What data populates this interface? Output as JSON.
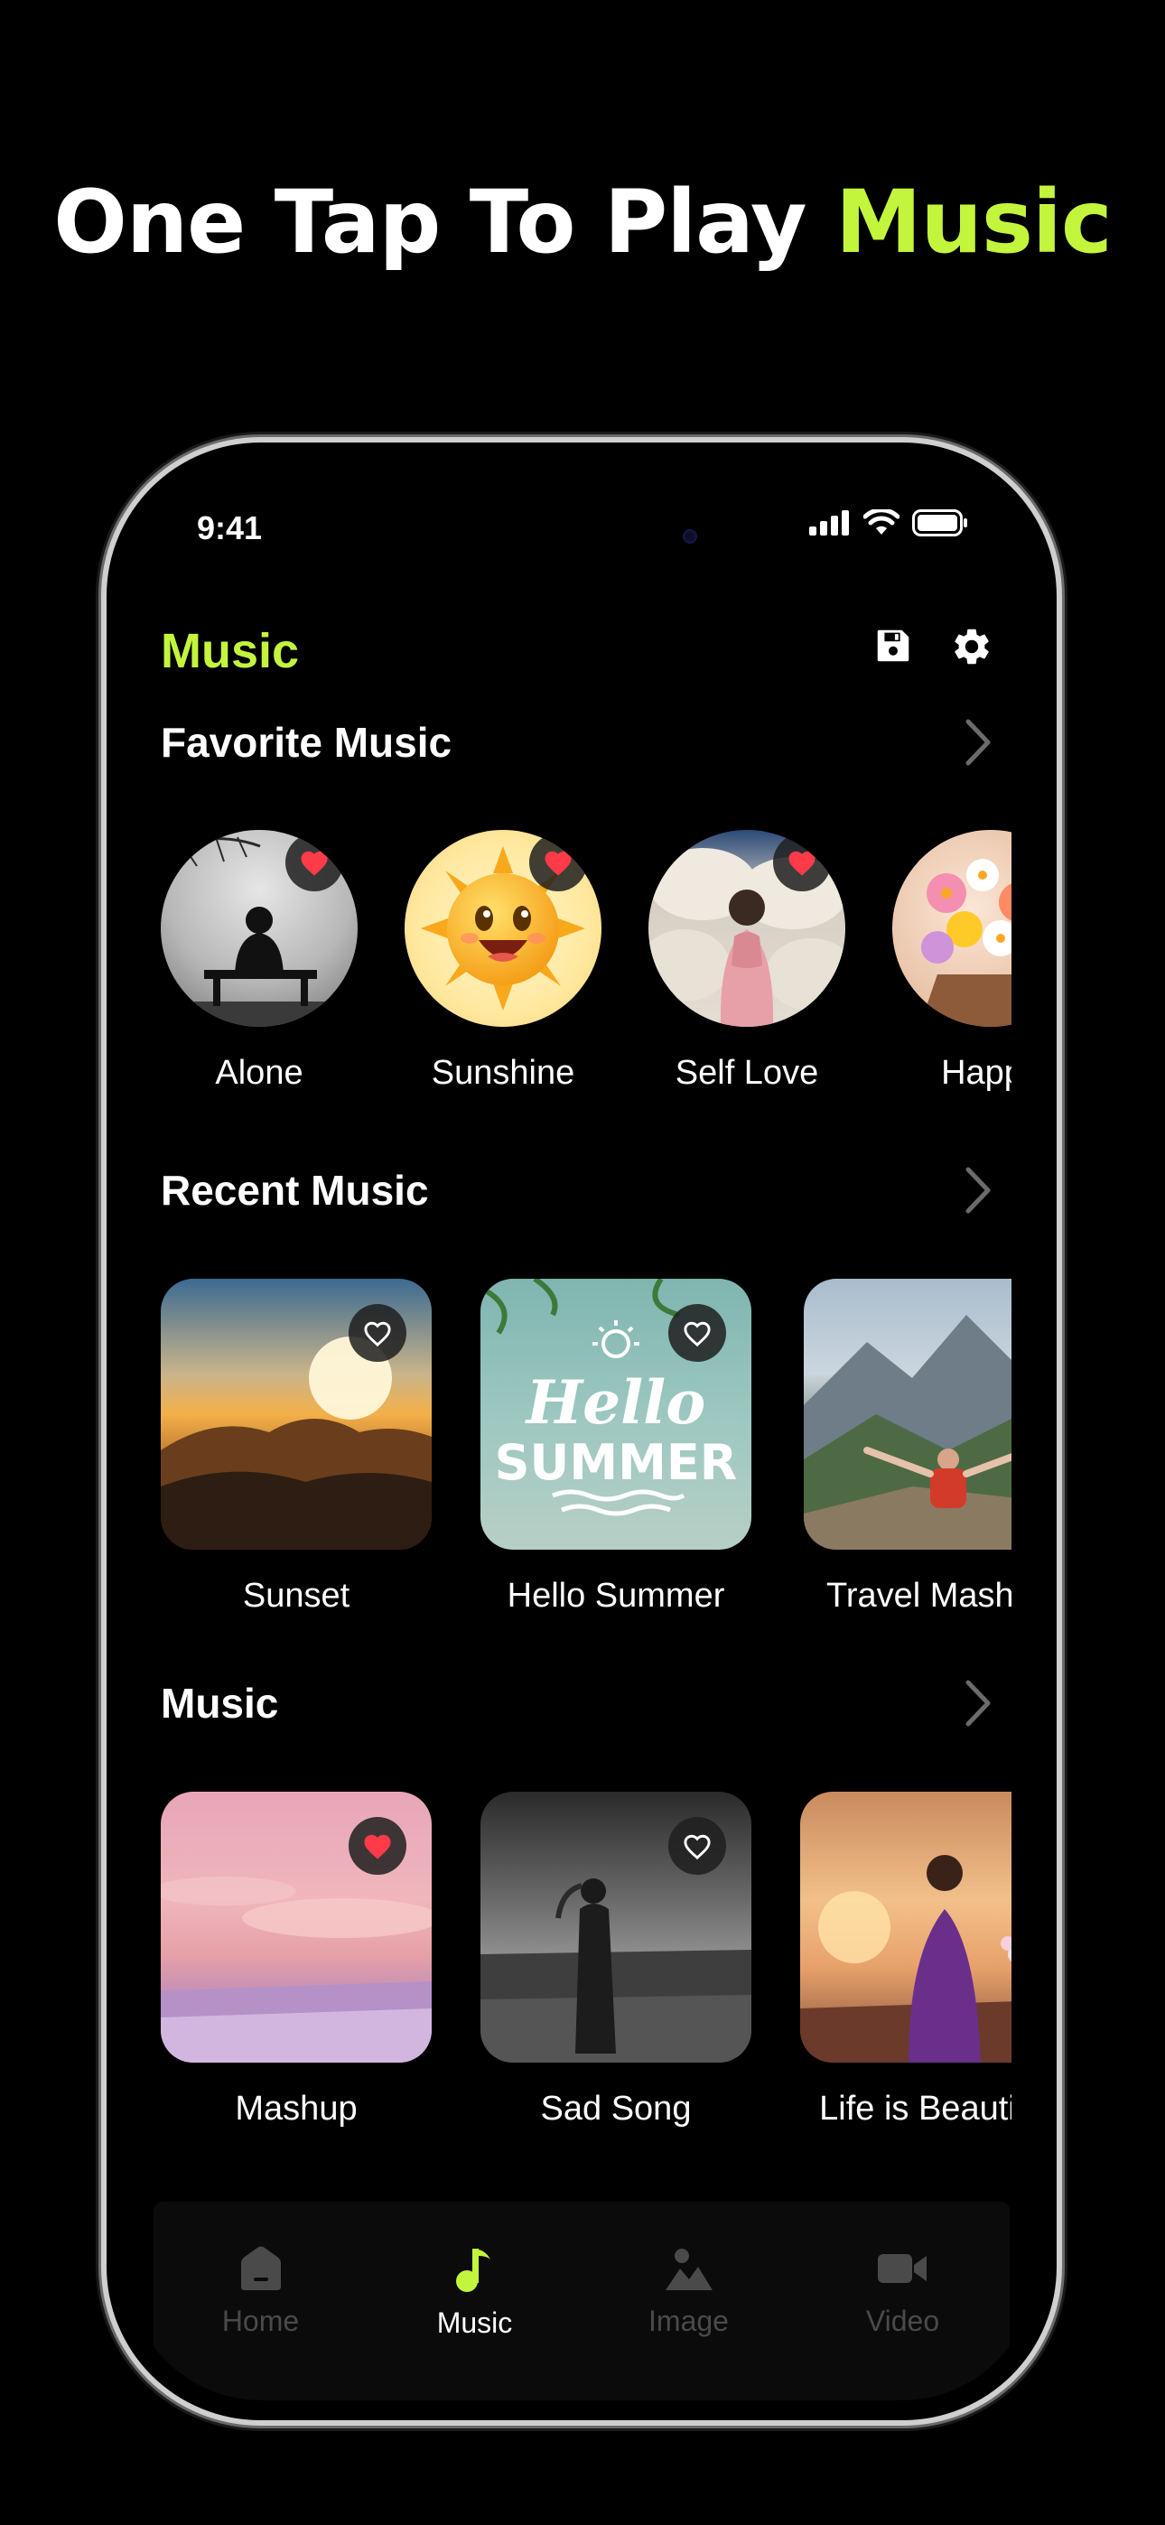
{
  "headline": {
    "part1": "One Tap To Play ",
    "part2": "Music"
  },
  "status": {
    "time": "9:41"
  },
  "header": {
    "title": "Music"
  },
  "colors": {
    "accent": "#C3F53C",
    "heart_red": "#FF3B4A"
  },
  "favorite": {
    "title": "Favorite Music",
    "items": [
      {
        "label": "Alone",
        "liked": true
      },
      {
        "label": "Sunshine",
        "liked": true
      },
      {
        "label": "Self Love",
        "liked": true
      },
      {
        "label": "Happy",
        "liked": false
      }
    ]
  },
  "recent": {
    "title": "Recent Music",
    "items": [
      {
        "label": "Sunset",
        "liked": false
      },
      {
        "label": "Hello Summer",
        "liked": false
      },
      {
        "label": "Travel Mashup",
        "liked": false
      }
    ]
  },
  "music": {
    "title": "Music",
    "items": [
      {
        "label": "Mashup",
        "liked": true
      },
      {
        "label": "Sad Song",
        "liked": false
      },
      {
        "label": "Life is Beautiful",
        "liked": false
      }
    ]
  },
  "card_art": {
    "hello_summer_line1": "Hello",
    "hello_summer_line2": "SUMMER"
  },
  "tabs": [
    {
      "label": "Home",
      "icon": "home-icon",
      "active": false
    },
    {
      "label": "Music",
      "icon": "music-note-icon",
      "active": true
    },
    {
      "label": "Image",
      "icon": "image-icon",
      "active": false
    },
    {
      "label": "Video",
      "icon": "video-icon",
      "active": false
    }
  ]
}
